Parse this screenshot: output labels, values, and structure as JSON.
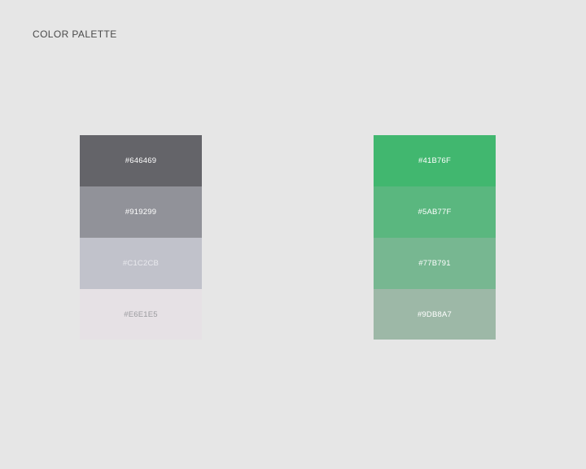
{
  "header": {
    "title": "COLOR PALETTE"
  },
  "palettes": [
    {
      "name": "gray",
      "swatches": [
        {
          "label": "#646469",
          "color": "#646469",
          "text_color": "#ffffff"
        },
        {
          "label": "#919299",
          "color": "#919299",
          "text_color": "#ffffff"
        },
        {
          "label": "#C1C2CB",
          "color": "#C1C2CB",
          "text_color": "#e9e9ee"
        },
        {
          "label": "#E6E1E5",
          "color": "#E6E1E5",
          "text_color": "#9a9a9e"
        }
      ]
    },
    {
      "name": "green",
      "swatches": [
        {
          "label": "#41B76F",
          "color": "#41B76F",
          "text_color": "#ffffff"
        },
        {
          "label": "#5AB77F",
          "color": "#5AB77F",
          "text_color": "#ffffff"
        },
        {
          "label": "#77B791",
          "color": "#77B791",
          "text_color": "#ffffff"
        },
        {
          "label": "#9DB8A7",
          "color": "#9DB8A7",
          "text_color": "#ffffff"
        }
      ]
    }
  ]
}
